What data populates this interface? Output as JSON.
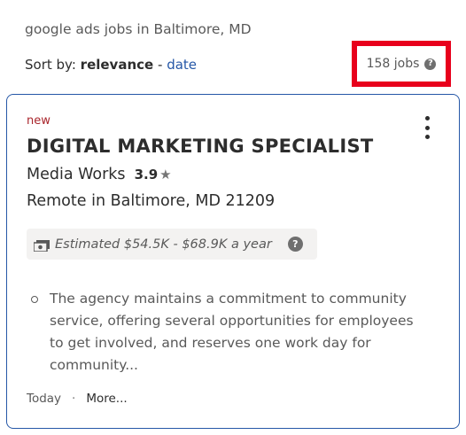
{
  "search": {
    "query_text": "google ads jobs in Baltimore, MD"
  },
  "sort": {
    "label": "Sort by:",
    "active": "relevance",
    "separator": "-",
    "alternate": "date"
  },
  "results": {
    "count_text": "158 jobs",
    "help_glyph": "?",
    "highlight_color": "#e8001c"
  },
  "job": {
    "new_label": "new",
    "title": "DIGITAL MARKETING SPECIALIST",
    "company": "Media Works",
    "rating": "3.9",
    "rating_star": "★",
    "location": "Remote in Baltimore, MD 21209",
    "salary": "Estimated $54.5K - $68.9K a year",
    "salary_help_glyph": "?",
    "snippet": "The agency maintains a commitment to community service, offering several opportunities for employees to get involved, and reserves one work day for community...",
    "posted": "Today",
    "footer_separator": "·",
    "more_label": "More..."
  },
  "colors": {
    "accent_link": "#2557a7",
    "new_tag": "#a9252b",
    "card_border": "#2557a7"
  },
  "icons": {
    "salary": "money-bill-icon",
    "menu": "more-vertical-icon",
    "help": "question-circle-icon",
    "rating": "star-icon"
  }
}
